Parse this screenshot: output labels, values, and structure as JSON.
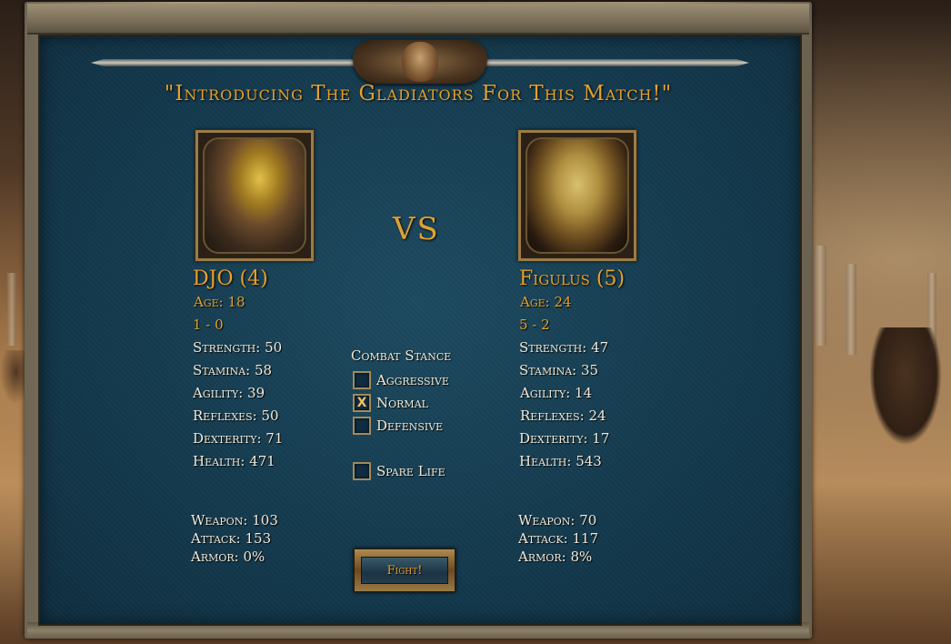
{
  "title": "\"Introducing The Gladiators For This Match!\"",
  "vs_label": "VS",
  "gladiator_left": {
    "name": "DJO (4)",
    "age": "Age: 18",
    "record": "1 - 0",
    "stats": {
      "strength": "Strength: 50",
      "stamina": "Stamina: 58",
      "agility": "Agility: 39",
      "reflexes": "Reflexes: 50",
      "dexterity": "Dexterity: 71",
      "health": "Health: 471"
    },
    "equipment": {
      "weapon": "Weapon: 103",
      "attack": "Attack: 153",
      "armor": "Armor: 0%"
    }
  },
  "gladiator_right": {
    "name": "Figulus (5)",
    "age": "Age: 24",
    "record": "5 - 2",
    "stats": {
      "strength": "Strength: 47",
      "stamina": "Stamina: 35",
      "agility": "Agility: 14",
      "reflexes": "Reflexes: 24",
      "dexterity": "Dexterity: 17",
      "health": "Health: 543"
    },
    "equipment": {
      "weapon": "Weapon: 70",
      "attack": "Attack: 117",
      "armor": "Armor: 8%"
    }
  },
  "combat_stance": {
    "title": "Combat Stance",
    "options": [
      {
        "label": "Aggressive",
        "mark": ""
      },
      {
        "label": "Normal",
        "mark": "X"
      },
      {
        "label": "Defensive",
        "mark": ""
      }
    ],
    "spare_life": {
      "label": "Spare Life",
      "mark": ""
    }
  },
  "fight_button": "Fight!",
  "colors": {
    "accent": "#e8a02a",
    "text": "#f2ead8",
    "panel": "#143a4e"
  }
}
